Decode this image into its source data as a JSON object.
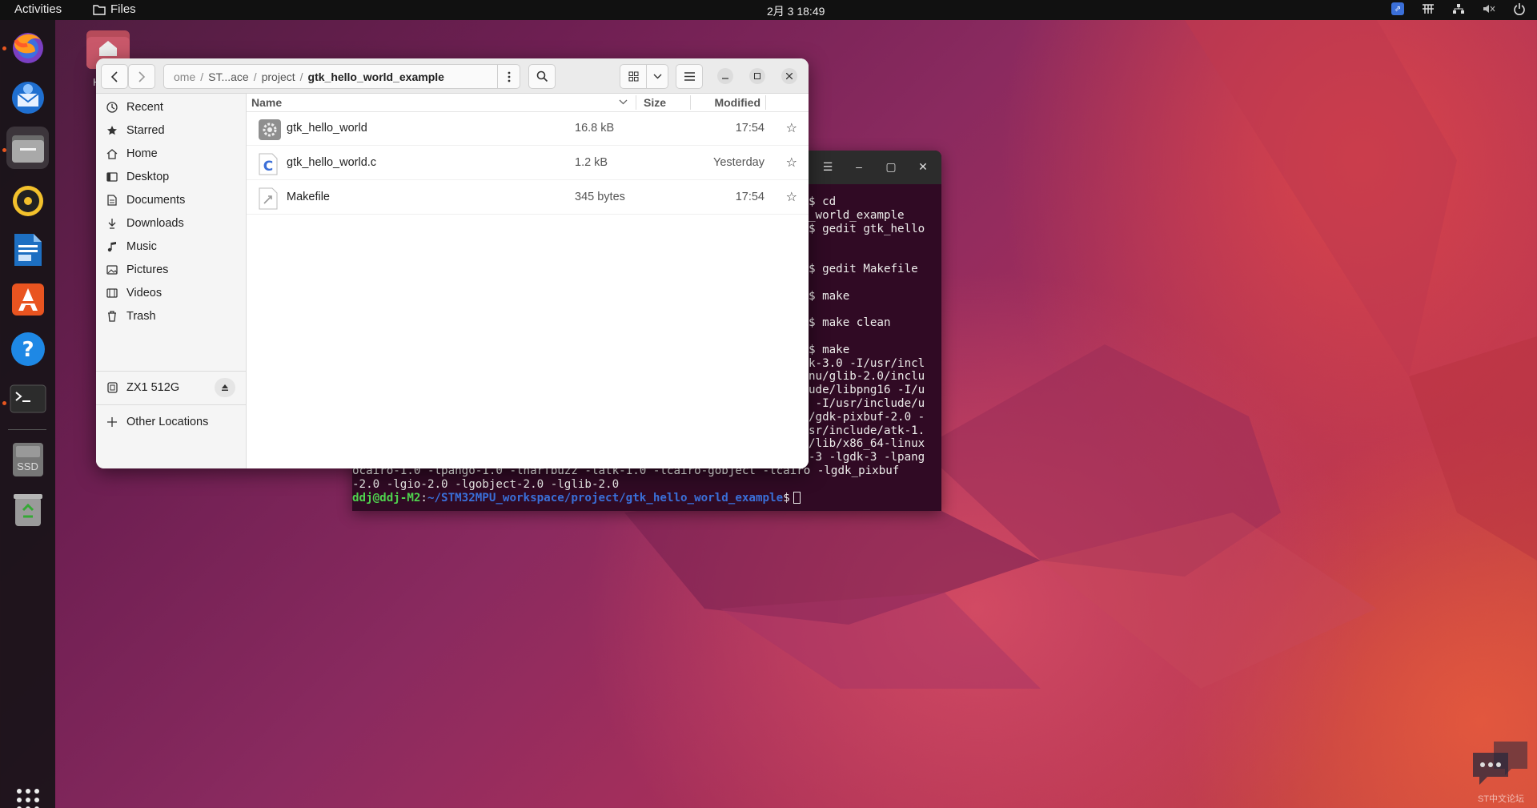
{
  "topbar": {
    "activities": "Activities",
    "app_name": "Files",
    "clock": "2月 3  18:49"
  },
  "dock": {
    "items": [
      "firefox-icon",
      "thunderbird-icon",
      "files-icon",
      "rhythmbox-icon",
      "libreoffice-writer-icon",
      "app-center-icon",
      "help-icon",
      "terminal-icon",
      "ssd-drive-icon",
      "trash-icon"
    ],
    "ssd_label": "SSD"
  },
  "desktop": {
    "home_partial_label": "H"
  },
  "terminal": {
    "lines": [
      {
        "left": "",
        "right": "$ cd"
      },
      {
        "left": "",
        "right": "_world_example"
      },
      {
        "left": "",
        "right": "$ gedit gtk_hello"
      },
      {
        "left": "",
        "right": ""
      },
      {
        "left": "",
        "right": ""
      },
      {
        "left": "",
        "right": "$ gedit Makefile"
      },
      {
        "left": "",
        "right": ""
      },
      {
        "left": "",
        "right": "$ make"
      },
      {
        "left": "",
        "right": ""
      },
      {
        "left": "",
        "right": "$ make clean"
      },
      {
        "left": "",
        "right": ""
      },
      {
        "left": "",
        "right": "$ make"
      },
      {
        "left": "",
        "right": "k-3.0 -I/usr/incl"
      },
      {
        "left": "",
        "right": "nu/glib-2.0/inclu"
      },
      {
        "left": "",
        "right": "ude/libpng16 -I/u"
      },
      {
        "left": "",
        "right": " -I/usr/include/u"
      },
      {
        "left": "",
        "right": "/gdk-pixbuf-2.0 -"
      },
      {
        "left": "",
        "right": "sr/include/atk-1."
      },
      {
        "left": "",
        "right": "/lib/x86_64-linux"
      },
      {
        "left": "",
        "right": "-3 -lgdk-3 -lpang"
      },
      {
        "left": "ocairo-1.0 -lpango-1.0 -lharfbuzz -latk-1.0 -lcairo-gobject -lcairo -lgdk_pixbuf",
        "right": ""
      },
      {
        "left": "-2.0 -lgio-2.0 -lgobject-2.0 -lglib-2.0",
        "right": ""
      }
    ],
    "prompt_user": "ddj@ddj-M2",
    "prompt_colon": ":",
    "prompt_path": "~/STM32MPU_workspace/project/gtk_hello_world_example",
    "prompt_symbol": "$"
  },
  "files": {
    "breadcrumbs": [
      "ome",
      "ST...ace",
      "project",
      "gtk_hello_world_example"
    ],
    "sidebar": [
      {
        "label": "Recent",
        "icon": "clock-icon"
      },
      {
        "label": "Starred",
        "icon": "star-icon"
      },
      {
        "label": "Home",
        "icon": "home-icon"
      },
      {
        "label": "Desktop",
        "icon": "desktop-icon"
      },
      {
        "label": "Documents",
        "icon": "document-icon"
      },
      {
        "label": "Downloads",
        "icon": "download-icon"
      },
      {
        "label": "Music",
        "icon": "music-icon"
      },
      {
        "label": "Pictures",
        "icon": "picture-icon"
      },
      {
        "label": "Videos",
        "icon": "video-icon"
      },
      {
        "label": "Trash",
        "icon": "trash-icon"
      }
    ],
    "drive": {
      "label": "ZX1 512G"
    },
    "other_locations": "Other Locations",
    "columns": {
      "name": "Name",
      "size": "Size",
      "modified": "Modified"
    },
    "rows": [
      {
        "name": "gtk_hello_world",
        "size": "16.8 kB",
        "modified": "17:54",
        "icon": "executable-icon"
      },
      {
        "name": "gtk_hello_world.c",
        "size": "1.2 kB",
        "modified": "Yesterday",
        "icon": "c-source-icon"
      },
      {
        "name": "Makefile",
        "size": "345 bytes",
        "modified": "17:54",
        "icon": "makefile-icon"
      }
    ]
  },
  "watermark": {
    "text": "ST中文论坛"
  }
}
